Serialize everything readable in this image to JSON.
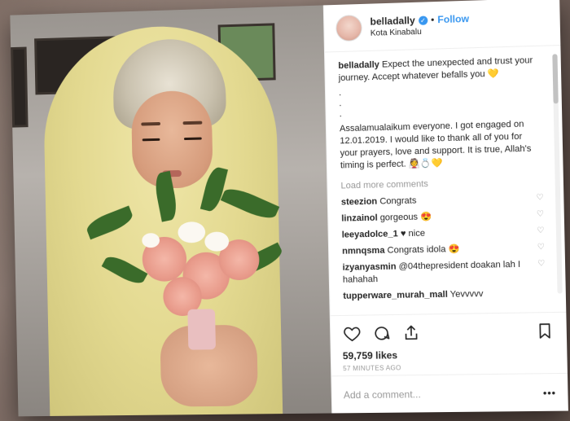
{
  "post": {
    "username": "belladally",
    "follow_label": "Follow",
    "location": "Kota Kinabalu",
    "caption_user": "belladally",
    "caption_text": "Expect the unexpected and trust your journey. Accept whatever befalls you",
    "caption_emoji": "💛",
    "caption_dots": [
      ".",
      ".",
      "."
    ],
    "caption_body": "Assalamualaikum everyone. I got engaged on 12.01.2019. I would like to thank all of you for your prayers, love and support. It is true, Allah's timing is perfect.",
    "caption_body_emoji": "👰💍💛"
  },
  "load_more_label": "Load more comments",
  "comments": [
    {
      "user": "steezion",
      "text": "Congrats"
    },
    {
      "user": "linzainol",
      "text": "gorgeous",
      "emoji": "😍"
    },
    {
      "user": "leeyadolce_1",
      "text": "♥ nice"
    },
    {
      "user": "nmnqsma",
      "text": "Congrats idola",
      "emoji": "😍"
    },
    {
      "user": "izyanyasmin",
      "text": "@04thepresident doakan lah I hahahah"
    },
    {
      "user": "tupperware_murah_mall",
      "text": "Yevvvvv"
    }
  ],
  "likes": "59,759 likes",
  "time_ago": "57 MINUTES AGO",
  "add_comment_placeholder": "Add a comment...",
  "more_label": "•••"
}
